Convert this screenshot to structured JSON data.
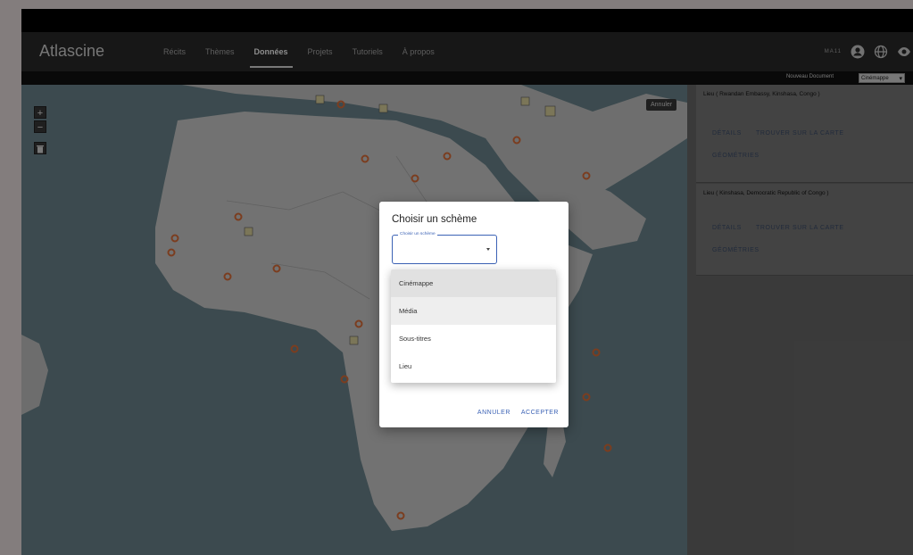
{
  "app": {
    "brand": "Atlascine",
    "nav": [
      "Récits",
      "Thèmes",
      "Données",
      "Projets",
      "Tutoriels",
      "À propos"
    ],
    "active_nav": "Données",
    "user_code": "MA11"
  },
  "subbar": {
    "new_document": "Nouveau Document",
    "schema_selected": "Cinémappe"
  },
  "map": {
    "zoom_in": "+",
    "zoom_out": "−",
    "cancel": "Annuler"
  },
  "panel": {
    "cards": [
      {
        "title": "Lieu ( Rwandan Embassy, Kinshasa, Congo )",
        "details": "DÉTAILS",
        "find": "TROUVER SUR LA CARTE",
        "geometries": "GÉOMÉTRIES"
      },
      {
        "title": "Lieu ( Kinshasa, Democratic Republic of Congo )",
        "details": "DÉTAILS",
        "find": "TROUVER SUR LA CARTE",
        "geometries": "GÉOMÉTRIES"
      }
    ]
  },
  "dialog": {
    "title": "Choisir un schème",
    "field_label": "Choisir un schème",
    "options": [
      "Cinémappe",
      "Média",
      "Sous-titres",
      "Lieu"
    ],
    "cancel": "ANNULER",
    "accept": "ACCEPTER"
  },
  "colors": {
    "accent": "#3b62b5",
    "marker": "#e0703a",
    "overlay": "rgba(0,0,0,0.45)"
  }
}
